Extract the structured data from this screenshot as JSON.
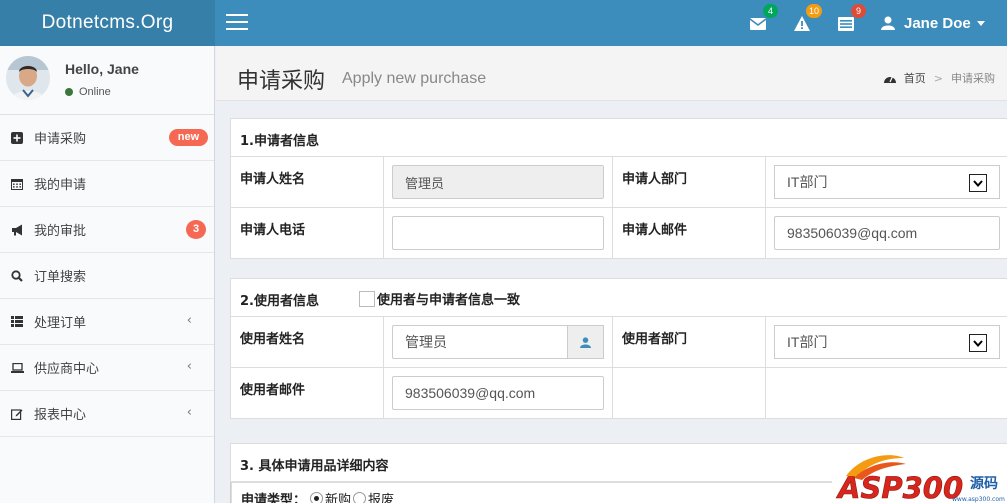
{
  "header": {
    "logo": "Dotnetcms.Org",
    "mail_badge": "4",
    "warning_badge": "10",
    "tasks_badge": "9",
    "user_name": "Jane Doe",
    "colors": {
      "header": "#3c8dbc",
      "logo": "#367fa9",
      "badge_green": "#00a65a",
      "badge_yellow": "#f39c12",
      "badge_red": "#dd4b39"
    }
  },
  "sidebar": {
    "greeting": "Hello, Jane",
    "status": "Online",
    "items": [
      {
        "label": "申请采购",
        "icon": "plus-square-icon",
        "badge": "new"
      },
      {
        "label": "我的申请",
        "icon": "calendar-icon"
      },
      {
        "label": "我的审批",
        "icon": "bullhorn-icon",
        "badge": "3"
      },
      {
        "label": "订单搜索",
        "icon": "search-icon"
      },
      {
        "label": "处理订单",
        "icon": "list-icon",
        "expandable": true
      },
      {
        "label": "供应商中心",
        "icon": "laptop-icon",
        "expandable": true
      },
      {
        "label": "报表中心",
        "icon": "edit-icon",
        "expandable": true
      }
    ]
  },
  "page": {
    "title": "申请采购",
    "subtitle": "Apply new purchase",
    "breadcrumb_home": "首页",
    "breadcrumb_sep": ">",
    "breadcrumb_current": "申请采购"
  },
  "applicant": {
    "section_title": "1.申请者信息",
    "name_label": "申请人姓名",
    "name_value": "管理员",
    "dept_label": "申请人部门",
    "dept_value": "IT部门",
    "phone_label": "申请人电话",
    "phone_value": "",
    "email_label": "申请人邮件",
    "email_value": "983506039@qq.com"
  },
  "user": {
    "section_title": "2.使用者信息",
    "same_checkbox_label": "使用者与申请者信息一致",
    "name_label": "使用者姓名",
    "name_value": "管理员",
    "dept_label": "使用者部门",
    "dept_value": "IT部门",
    "email_label": "使用者邮件",
    "email_value": "983506039@qq.com"
  },
  "details": {
    "section_title": "3. 具体申请用品详细内容",
    "type_label": "申请类型：",
    "type_options": [
      "新购",
      "报废"
    ]
  },
  "watermark": {
    "text": "ASP300",
    "text2": "源码",
    "domain": "www.asp300.com"
  }
}
